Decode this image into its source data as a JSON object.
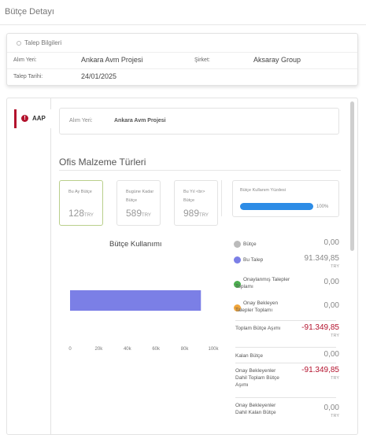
{
  "header": {
    "title": "Bütçe Detayı"
  },
  "talep": {
    "title": "Talep Bilgileri",
    "alim_yeri_label": "Alım Yeri:",
    "alim_yeri_value": "Ankara Avm Projesi",
    "sirket_label": "Şirket:",
    "sirket_value": "Aksaray Group",
    "tarih_label": "Talep Tarihi:",
    "tarih_value": "24/01/2025"
  },
  "tab": {
    "label": "AAP",
    "icon": "exclamation-circle-icon",
    "color": "#b3122d"
  },
  "detail": {
    "alim_label": "Alım Yeri:",
    "alim_value": "Ankara Avm Projesi",
    "section_title": "Ofis Malzeme Türleri",
    "cards": [
      {
        "label": "Bu Ay Bütçe",
        "value": "128",
        "currency": "TRY"
      },
      {
        "label": "Bugüne Kadar Bütçe",
        "value": "589",
        "currency": "TRY"
      },
      {
        "label": "Bu Yıl <br> Bütçe",
        "value": "989",
        "currency": "TRY"
      }
    ],
    "usage": {
      "label": "Bütçe Kullanım Yüzdesi",
      "percent": 100,
      "percent_text": "100%",
      "color": "#2d8ce6"
    }
  },
  "legend": [
    {
      "name": "Bütçe",
      "value": "0,00",
      "currency": "TRY",
      "color": "#bbbbbb"
    },
    {
      "name": "Bu Talep",
      "value": "91.349,85",
      "currency": "TRY",
      "color": "#7b7fe6"
    },
    {
      "name": "Onaylanmış Talepler Toplamı",
      "value": "0,00",
      "currency": "TRY",
      "color": "#4caf50"
    },
    {
      "name": "Onay Bekleyen Talepler Toplamı",
      "value": "0,00",
      "currency": "TRY",
      "color": "#f0a53a"
    },
    {
      "name": "Toplam Bütçe Aşımı",
      "value": "-91.349,85",
      "currency": "TRY"
    },
    {
      "name": "Kalan Bütçe",
      "value": "0,00",
      "currency": "TRY"
    },
    {
      "name": "Onay Bekleyenler Dahil Toplam Bütçe Aşımı",
      "value": "-91.349,85",
      "currency": "TRY"
    },
    {
      "name": "Onay Bekleyenler Dahil Kalan Bütçe",
      "value": "0,00",
      "currency": "TRY"
    }
  ],
  "chart_data": {
    "type": "bar",
    "orientation": "horizontal",
    "title": "Bütçe Kullanımı",
    "categories": [
      ""
    ],
    "series": [
      {
        "name": "Bu Talep",
        "values": [
          91349.85
        ],
        "color": "#7b7fe6"
      }
    ],
    "x_ticks": [
      "0",
      "20k",
      "40k",
      "60k",
      "80k",
      "100k"
    ],
    "xlim": [
      0,
      100000
    ],
    "grid": false
  }
}
